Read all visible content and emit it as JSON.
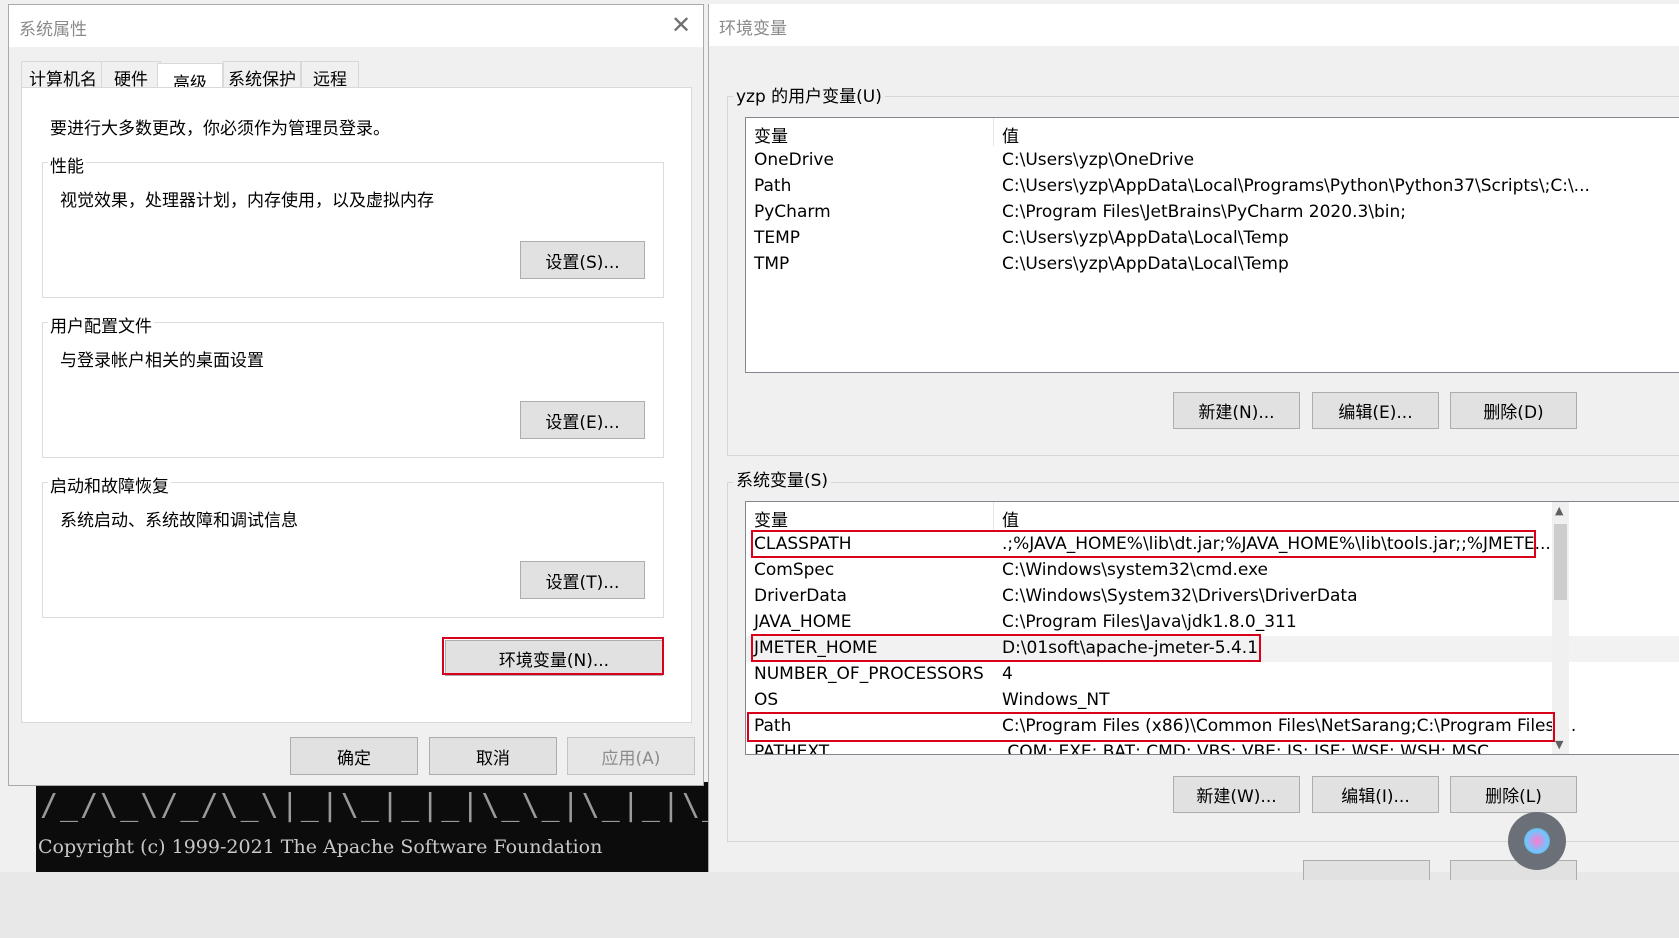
{
  "system_properties": {
    "title": "系统属性",
    "tabs": [
      {
        "label": "计算机名"
      },
      {
        "label": "硬件"
      },
      {
        "label": "高级"
      },
      {
        "label": "系统保护"
      },
      {
        "label": "远程"
      }
    ],
    "admin_note": "要进行大多数更改，你必须作为管理员登录。",
    "performance": {
      "title": "性能",
      "desc": "视觉效果，处理器计划，内存使用，以及虚拟内存",
      "button": "设置(S)..."
    },
    "user_profiles": {
      "title": "用户配置文件",
      "desc": "与登录帐户相关的桌面设置",
      "button": "设置(E)..."
    },
    "startup_recovery": {
      "title": "启动和故障恢复",
      "desc": "系统启动、系统故障和调试信息",
      "button": "设置(T)..."
    },
    "env_button": "环境变量(N)...",
    "ok": "确定",
    "cancel": "取消",
    "apply": "应用(A)"
  },
  "env_vars": {
    "title": "环境变量",
    "user_section_title": "yzp 的用户变量(U)",
    "columns": {
      "name": "变量",
      "value": "值"
    },
    "user_vars": [
      {
        "name": "OneDrive",
        "value": "C:\\Users\\yzp\\OneDrive"
      },
      {
        "name": "Path",
        "value": "C:\\Users\\yzp\\AppData\\Local\\Programs\\Python\\Python37\\Scripts\\;C:\\..."
      },
      {
        "name": "PyCharm",
        "value": "C:\\Program Files\\JetBrains\\PyCharm 2020.3\\bin;"
      },
      {
        "name": "TEMP",
        "value": "C:\\Users\\yzp\\AppData\\Local\\Temp"
      },
      {
        "name": "TMP",
        "value": "C:\\Users\\yzp\\AppData\\Local\\Temp"
      }
    ],
    "user_buttons": {
      "new": "新建(N)...",
      "edit": "编辑(E)...",
      "delete": "删除(D)"
    },
    "system_section_title": "系统变量(S)",
    "system_vars": [
      {
        "name": "CLASSPATH",
        "value": ".;%JAVA_HOME%\\lib\\dt.jar;%JAVA_HOME%\\lib\\tools.jar;;%JMETE..."
      },
      {
        "name": "ComSpec",
        "value": "C:\\Windows\\system32\\cmd.exe"
      },
      {
        "name": "DriverData",
        "value": "C:\\Windows\\System32\\Drivers\\DriverData"
      },
      {
        "name": "JAVA_HOME",
        "value": "C:\\Program Files\\Java\\jdk1.8.0_311"
      },
      {
        "name": "JMETER_HOME",
        "value": "D:\\01soft\\apache-jmeter-5.4.1"
      },
      {
        "name": "NUMBER_OF_PROCESSORS",
        "value": "4"
      },
      {
        "name": "OS",
        "value": "Windows_NT"
      },
      {
        "name": "Path",
        "value": "C:\\Program Files (x86)\\Common Files\\NetSarang;C:\\Program Files\\..."
      },
      {
        "name": "PATHEXT",
        "value": ".COM;.EXE;.BAT;.CMD;.VBS;.VBE;.JS;.JSE;.WSF;.WSH;.MSC"
      }
    ],
    "system_buttons": {
      "new": "新建(W)...",
      "edit": "编辑(I)...",
      "delete": "删除(L)"
    }
  },
  "console": {
    "copyright": "Copyright (c) 1999-2021 The Apache Software Foundation"
  }
}
